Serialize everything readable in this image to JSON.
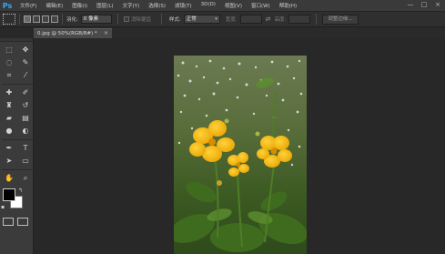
{
  "app": {
    "logo": "Ps"
  },
  "menu": [
    "文件(F)",
    "编辑(E)",
    "图像(I)",
    "图层(L)",
    "文字(Y)",
    "选择(S)",
    "滤镜(T)",
    "3D(D)",
    "视图(V)",
    "窗口(W)",
    "帮助(H)"
  ],
  "window_controls": {
    "minimize": "—",
    "maximize": "□",
    "close": "×"
  },
  "options": {
    "feather_label": "羽化:",
    "feather_value": "0 像素",
    "antialias_label": "消除锯齿",
    "style_label": "样式:",
    "style_value": "正常",
    "width_label": "宽度:",
    "height_label": "高度:",
    "refine_label": "调整边缘..."
  },
  "document": {
    "tab_title": "0.jpg @ 50%(RGB/8#) *",
    "close": "×"
  },
  "colors": {
    "foreground": "#000000",
    "background": "#ffffff"
  }
}
